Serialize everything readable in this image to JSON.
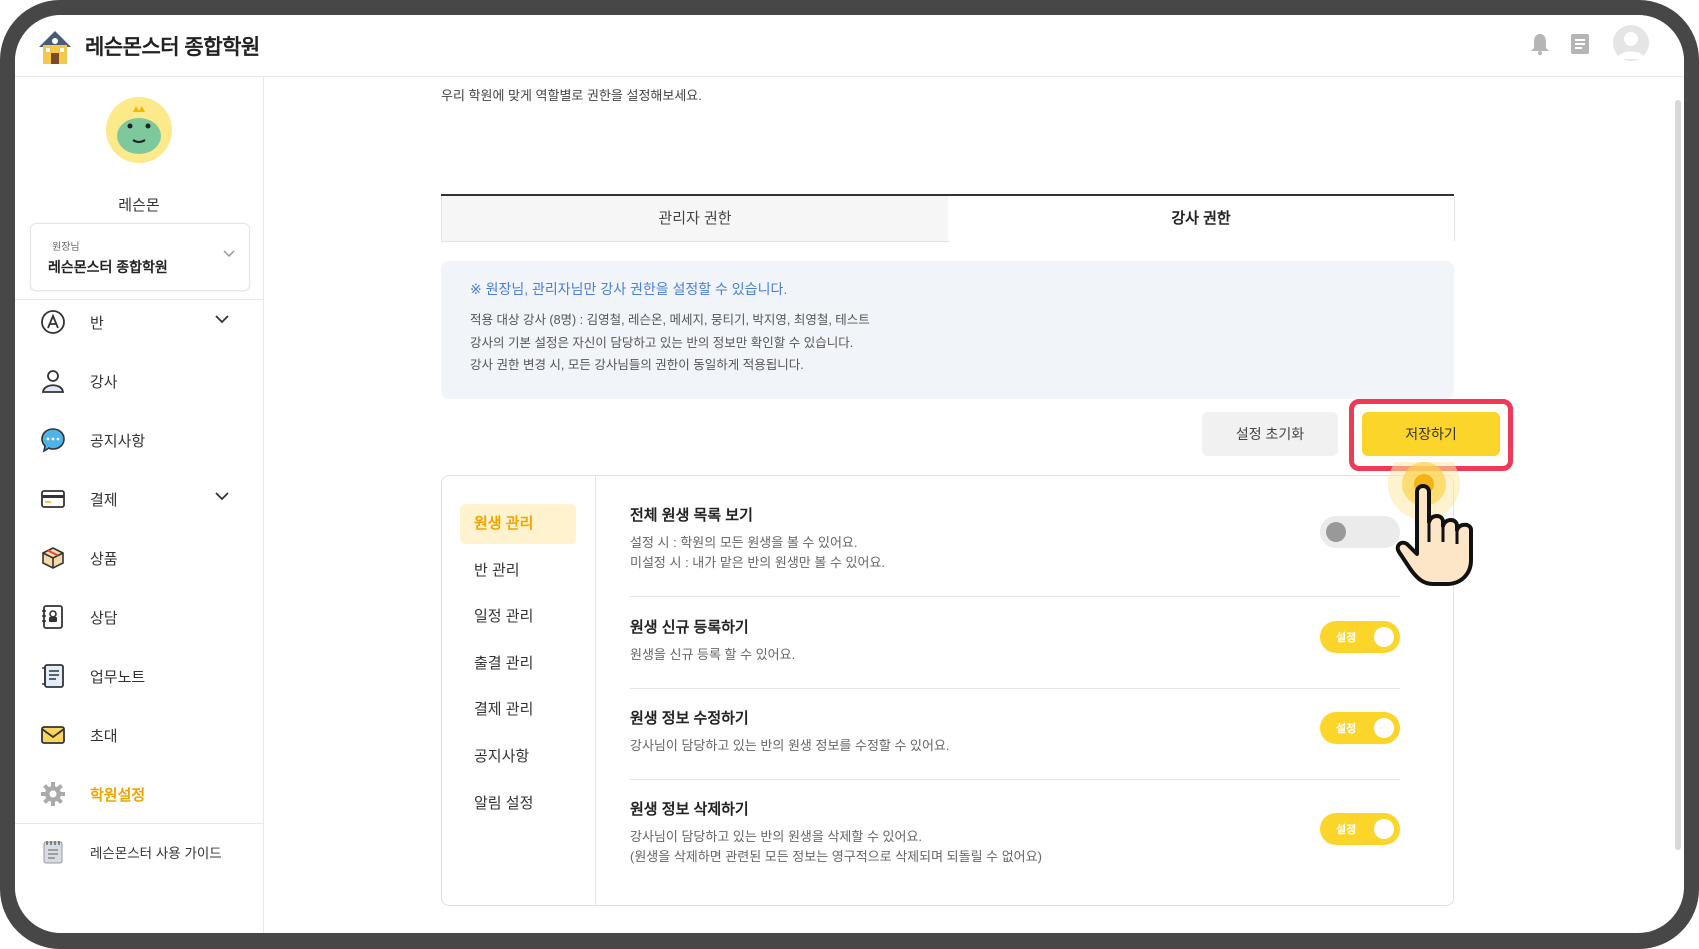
{
  "header": {
    "app_title": "레슨몬스터 종합학원",
    "icons": [
      "bell-icon",
      "document-icon",
      "user-avatar-icon"
    ]
  },
  "sidebar": {
    "profile_name": "레슨몬",
    "academy_role": "원장님",
    "academy_name": "레슨몬스터 종합학원",
    "items": [
      {
        "label": "반",
        "icon": "class-icon",
        "has_chevron": true
      },
      {
        "label": "강사",
        "icon": "person-icon"
      },
      {
        "label": "공지사항",
        "icon": "chat-bubble-icon"
      },
      {
        "label": "결제",
        "icon": "card-icon",
        "has_chevron": true
      },
      {
        "label": "상품",
        "icon": "box-icon"
      },
      {
        "label": "상담",
        "icon": "contact-book-icon"
      },
      {
        "label": "업무노트",
        "icon": "notebook-icon"
      },
      {
        "label": "초대",
        "icon": "envelope-icon"
      },
      {
        "label": "학원설정",
        "icon": "gear-icon",
        "active": true
      }
    ],
    "guide_label": "레슨몬스터 사용 가이드"
  },
  "main": {
    "intro": "우리 학원에 맞게 역할별로 권한을 설정해보세요.",
    "tabs": [
      {
        "label": "관리자 권한",
        "active": false
      },
      {
        "label": "강사 권한",
        "active": true
      }
    ],
    "notice": {
      "title": "※ 원장님, 관리자님만 강사 권한을 설정할 수 있습니다.",
      "lines": [
        "적용 대상 강사 (8명) : 김영철, 레슨온, 메세지, 뭉티기, 박지영, 최영철, 테스트",
        "강사의 기본 설정은 자신이 담당하고 있는 반의 정보만 확인할 수 있습니다.",
        "강사 권한 변경 시, 모든 강사님들의 권한이 동일하게 적용됩니다."
      ]
    },
    "buttons": {
      "reset": "설정 초기화",
      "save": "저장하기"
    },
    "categories": [
      "원생 관리",
      "반 관리",
      "일정 관리",
      "출결 관리",
      "결제 관리",
      "공지사항",
      "알림 설정"
    ],
    "active_category": "원생 관리",
    "permissions": [
      {
        "title": "전체 원생 목록 보기",
        "desc1": "설정 시 : 학원의 모든 원생을 볼 수 있어요.",
        "desc2": "미설정 시 : 내가 맡은 반의 원생만 볼 수 있어요.",
        "enabled": false
      },
      {
        "title": "원생 신규 등록하기",
        "desc1": "원생을 신규 등록 할 수 있어요.",
        "desc2": "",
        "enabled": true
      },
      {
        "title": "원생 정보 수정하기",
        "desc1": "강사님이 담당하고 있는 반의 원생 정보를 수정할 수 있어요.",
        "desc2": "",
        "enabled": true
      },
      {
        "title": "원생 정보 삭제하기",
        "desc1": "강사님이 담당하고 있는 반의 원생을 삭제할 수 있어요.",
        "desc2": "(원생을 삭제하면 관련된 모든 정보는 영구적으로 삭제되며 되돌릴 수 없어요)",
        "enabled": true
      }
    ],
    "toggle_on_label": "설정"
  },
  "colors": {
    "accent_yellow": "#fcd52b",
    "active_orange": "#f0a500",
    "highlight_red": "#ee3a57",
    "notice_blue": "#4a7fd6"
  }
}
